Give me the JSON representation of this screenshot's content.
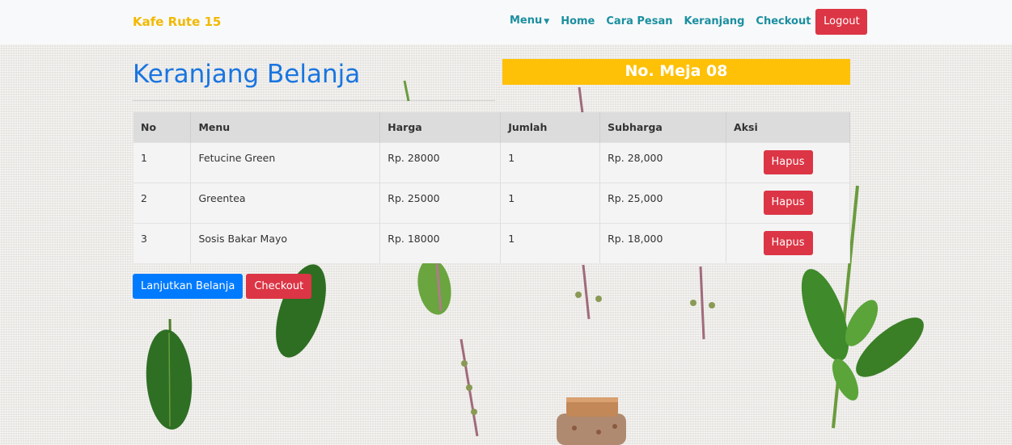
{
  "navbar": {
    "brand": "Kafe Rute 15",
    "menu_label": "Menu",
    "links": [
      "Home",
      "Cara Pesan",
      "Keranjang",
      "Checkout"
    ],
    "logout_label": "Logout"
  },
  "page": {
    "title": "Keranjang Belanja",
    "table_number": "No. Meja 08"
  },
  "cart": {
    "columns": [
      "No",
      "Menu",
      "Harga",
      "Jumlah",
      "Subharga",
      "Aksi"
    ],
    "rows": [
      {
        "no": "1",
        "menu": "Fetucine Green",
        "harga": "Rp. 28000",
        "jumlah": "1",
        "subharga": "Rp. 28,000",
        "action": "Hapus"
      },
      {
        "no": "2",
        "menu": "Greentea",
        "harga": "Rp. 25000",
        "jumlah": "1",
        "subharga": "Rp. 25,000",
        "action": "Hapus"
      },
      {
        "no": "3",
        "menu": "Sosis Bakar Mayo",
        "harga": "Rp. 18000",
        "jumlah": "1",
        "subharga": "Rp. 18,000",
        "action": "Hapus"
      }
    ]
  },
  "actions": {
    "continue_label": "Lanjutkan Belanja",
    "checkout_label": "Checkout"
  },
  "colors": {
    "brand": "#f2b900",
    "nav_link": "#1a8fa0",
    "title": "#1a75e0",
    "table_badge": "#ffc107",
    "danger": "#dc3545",
    "primary": "#007bff"
  }
}
